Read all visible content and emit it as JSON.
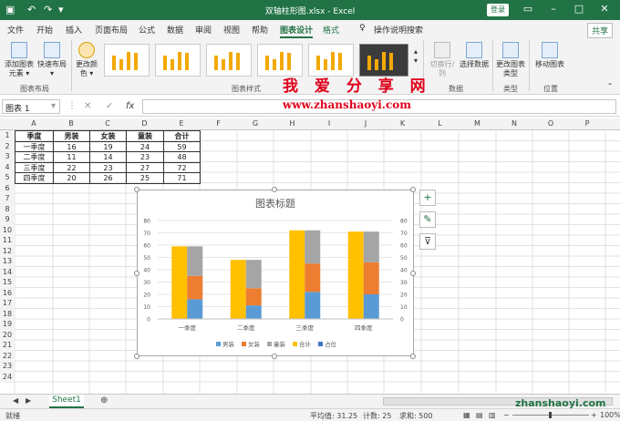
{
  "titlebar": {
    "filename": "双轴柱形图.xlsx  -  Excel",
    "login": "登录"
  },
  "tabs": [
    "文件",
    "开始",
    "插入",
    "页面布局",
    "公式",
    "数据",
    "审阅",
    "视图",
    "帮助",
    "图表设计",
    "格式"
  ],
  "active_tab": "图表设计",
  "tell_me": "操作说明搜索",
  "share": "共享",
  "ribbon": {
    "add_element": "添加图表元素 ▾",
    "quick_layout": "快速布局 ▾",
    "change_colors": "更改颜色 ▾",
    "switch_row_col": "切换行/列",
    "select_data": "选择数据",
    "change_type": "更改图表类型",
    "move_chart": "移动图表",
    "group_layout": "图表布局",
    "group_styles": "图表样式",
    "group_data": "数据",
    "group_type": "类型",
    "group_location": "位置"
  },
  "watermark": {
    "cn": "我 爱 分 享 网",
    "url": "www.zhanshaoyi.com",
    "url2": "zhanshaoyi.com"
  },
  "namebox": "图表 1",
  "columns": [
    "A",
    "B",
    "C",
    "D",
    "E",
    "F",
    "G",
    "H",
    "I",
    "J",
    "K",
    "L",
    "M",
    "N",
    "O",
    "P"
  ],
  "rows": [
    "1",
    "2",
    "3",
    "4",
    "5",
    "6",
    "7",
    "8",
    "9",
    "10",
    "11",
    "12",
    "13",
    "14",
    "15",
    "16",
    "17",
    "18",
    "19",
    "20",
    "21",
    "22",
    "23",
    "24"
  ],
  "table": {
    "headers": [
      "季度",
      "男装",
      "女装",
      "童装",
      "合计"
    ],
    "rows": [
      [
        "一季度",
        "16",
        "19",
        "24",
        "59"
      ],
      [
        "二季度",
        "11",
        "14",
        "23",
        "48"
      ],
      [
        "三季度",
        "22",
        "23",
        "27",
        "72"
      ],
      [
        "四季度",
        "20",
        "26",
        "25",
        "71"
      ]
    ]
  },
  "chart_data": {
    "type": "bar",
    "title": "图表标题",
    "categories": [
      "一季度",
      "二季度",
      "三季度",
      "四季度"
    ],
    "series": [
      {
        "name": "男装",
        "values": [
          16,
          11,
          22,
          20
        ],
        "color": "#5b9bd5"
      },
      {
        "name": "女装",
        "values": [
          19,
          14,
          23,
          26
        ],
        "color": "#ed7d31"
      },
      {
        "name": "童装",
        "values": [
          24,
          23,
          27,
          25
        ],
        "color": "#a5a5a5"
      },
      {
        "name": "合计",
        "values": [
          59,
          48,
          72,
          71
        ],
        "color": "#ffc000"
      },
      {
        "name": "占位",
        "values": [
          0,
          0,
          0,
          0
        ],
        "color": "#4472c4"
      }
    ],
    "ylim": [
      0,
      80
    ],
    "yticks": [
      "0",
      "10",
      "20",
      "30",
      "40",
      "50",
      "60",
      "70",
      "80"
    ],
    "legend": "bottom"
  },
  "sheet": "Sheet1",
  "status": {
    "ready": "就绪",
    "avg": "平均值: 31.25",
    "count": "计数: 25",
    "sum": "求和: 500",
    "zoom": "100%"
  }
}
